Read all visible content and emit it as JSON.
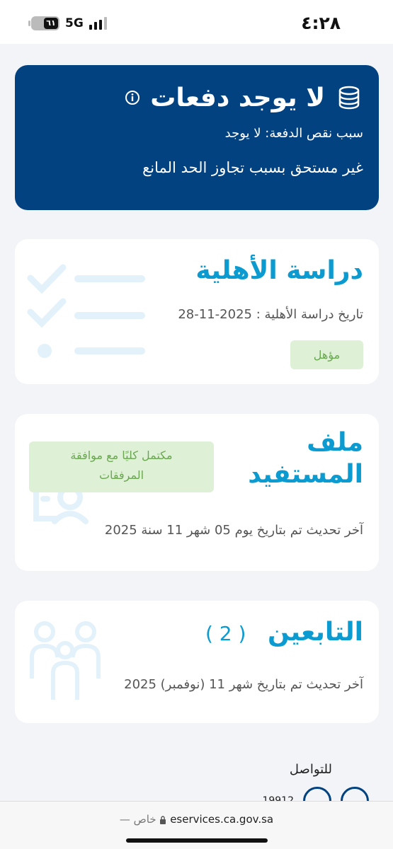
{
  "status_bar": {
    "time": "٤:٢٨",
    "network": "5G",
    "battery_level": "٦١"
  },
  "payment": {
    "title": "لا يوجد دفعات",
    "reason": "سبب نقص الدفعة: لا يوجد",
    "status": "غير مستحق بسبب تجاوز الحد المانع",
    "icon": "coins-icon",
    "info_icon": "info-icon"
  },
  "eligibility": {
    "title": "دراسة الأهلية",
    "date_text": "تاريخ دراسة الأهلية : 2025-11-28",
    "badge": "مؤهل"
  },
  "beneficiary_file": {
    "title_line1": "ملف",
    "title_line2": "المستفيد",
    "badge_line1": "مكتمل كليًا مع موافقة",
    "badge_line2": "المرفقات",
    "updated_text": "آخر تحديث تم بتاريخ يوم 05 شهر 11 سنة 2025"
  },
  "dependents": {
    "title": "التابعين",
    "count": "( 2 )",
    "updated_text": "آخر تحديث تم بتاريخ شهر 11 (نوفمبر) 2025"
  },
  "contact": {
    "label": "للتواصل",
    "phone_partial": "19912"
  },
  "browser": {
    "url": "eservices.ca.gov.sa",
    "private_label": "— خاص"
  },
  "colors": {
    "primary": "#024281",
    "accent": "#0b9bd0",
    "badge_bg": "#def0d6",
    "badge_text": "#6aa84f"
  }
}
